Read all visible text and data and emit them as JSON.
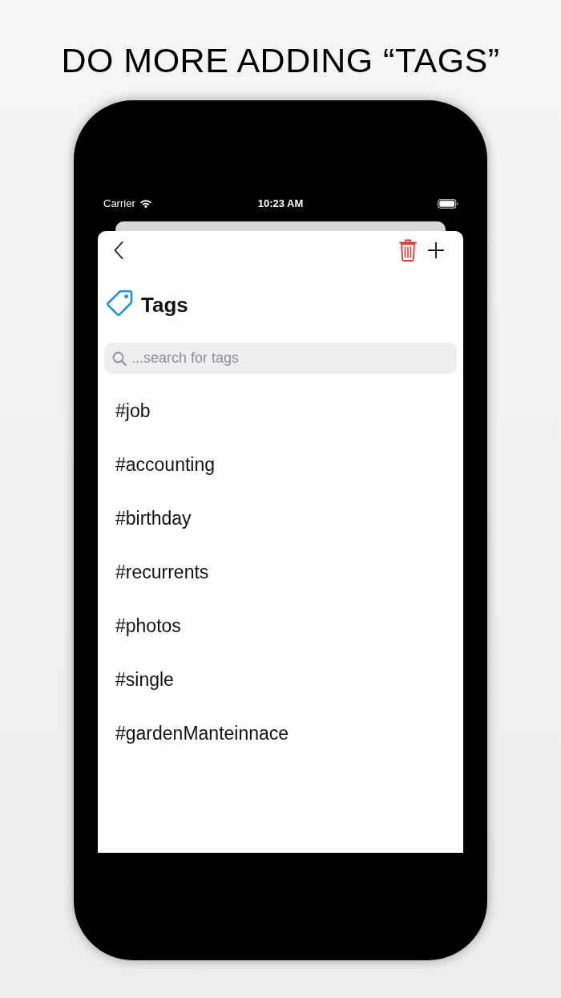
{
  "headline": "DO MORE ADDING “TAGS”",
  "status_bar": {
    "carrier": "Carrier",
    "time": "10:23 AM"
  },
  "header": {
    "title": "Tags"
  },
  "search": {
    "placeholder": "...search for tags"
  },
  "tags": [
    {
      "label": "#job"
    },
    {
      "label": "#accounting"
    },
    {
      "label": "#birthday"
    },
    {
      "label": "#recurrents"
    },
    {
      "label": "#photos"
    },
    {
      "label": "#single"
    },
    {
      "label": "#gardenManteinnace"
    }
  ]
}
